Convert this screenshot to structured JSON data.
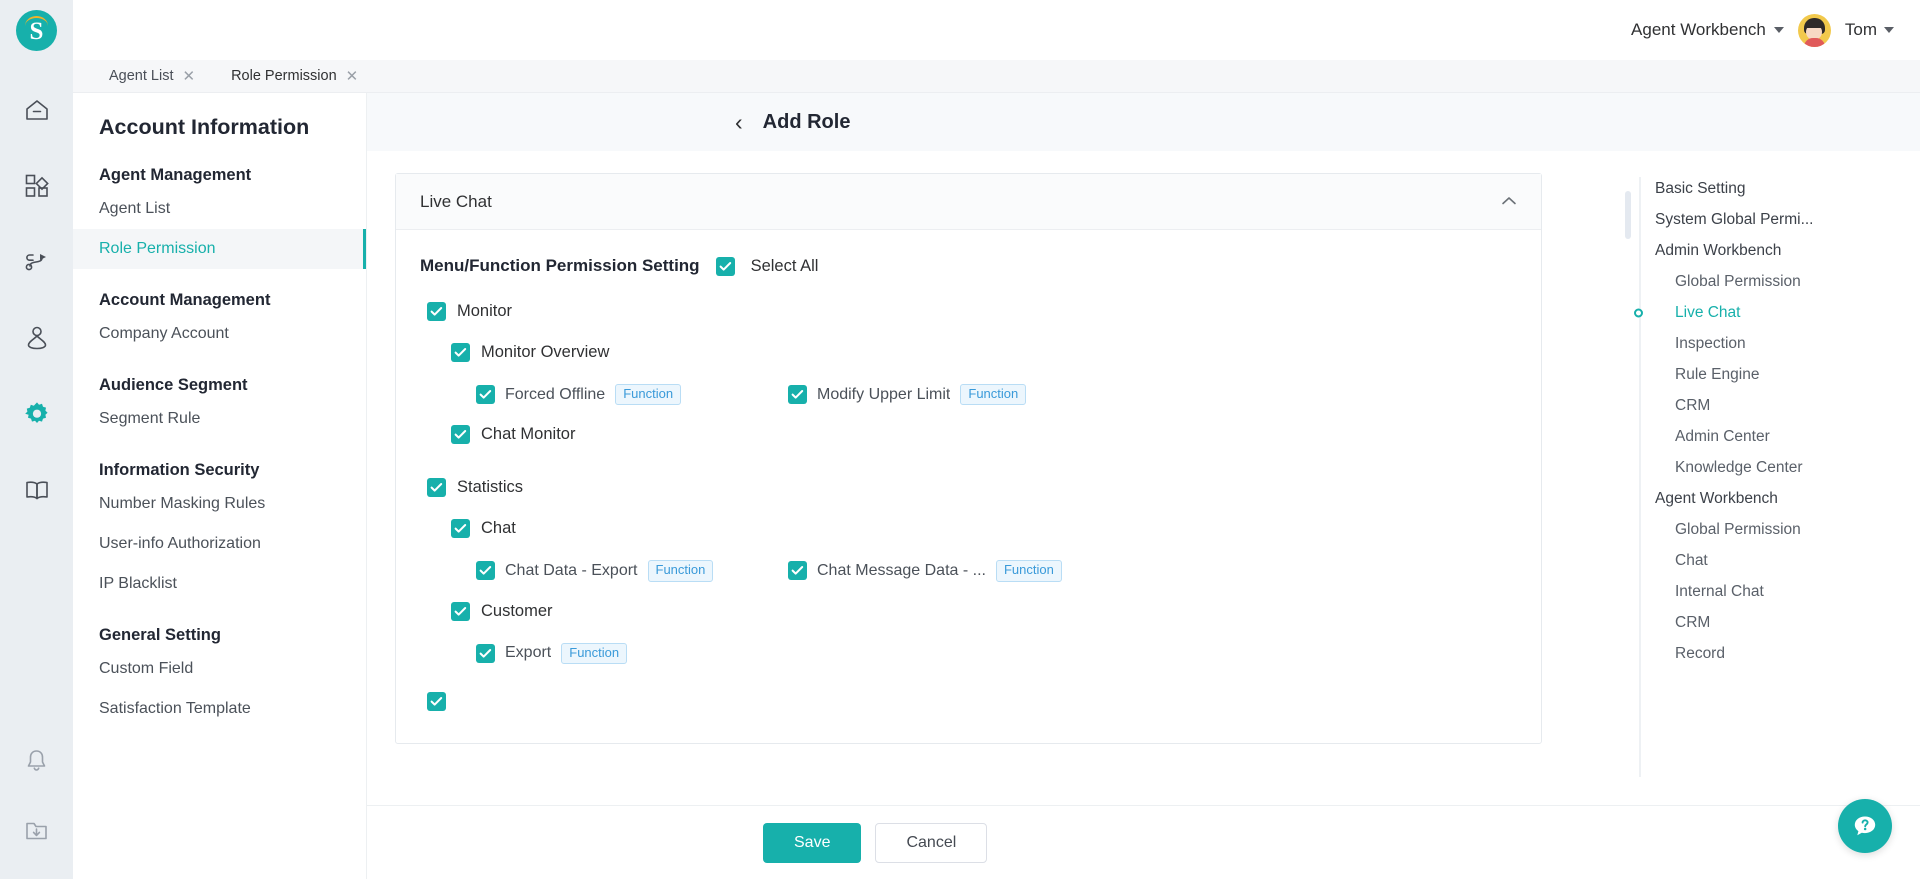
{
  "header": {
    "logo_letter": "S",
    "workbench_label": "Agent Workbench",
    "user_name": "Tom"
  },
  "rail": {
    "icons": [
      {
        "name": "home-icon"
      },
      {
        "name": "apps-grid-icon"
      },
      {
        "name": "routing-flow-icon"
      },
      {
        "name": "audience-person-icon"
      },
      {
        "name": "settings-gear-icon"
      },
      {
        "name": "knowledge-book-icon"
      }
    ],
    "bottom_icons": [
      {
        "name": "notification-bell-icon"
      },
      {
        "name": "download-folder-icon"
      }
    ]
  },
  "tabs": [
    {
      "label": "Agent List",
      "close": "✕"
    },
    {
      "label": "Role Permission",
      "close": "✕"
    }
  ],
  "sidebar": {
    "title": "Account Information",
    "groups": [
      {
        "title": "Agent Management",
        "items": [
          {
            "label": "Agent List",
            "active": false
          },
          {
            "label": "Role Permission",
            "active": true
          }
        ]
      },
      {
        "title": "Account Management",
        "items": [
          {
            "label": "Company Account",
            "active": false
          }
        ]
      },
      {
        "title": "Audience Segment",
        "items": [
          {
            "label": "Segment Rule",
            "active": false
          }
        ]
      },
      {
        "title": "Information Security",
        "items": [
          {
            "label": "Number Masking Rules",
            "active": false
          },
          {
            "label": "User-info Authorization",
            "active": false
          },
          {
            "label": "IP Blacklist",
            "active": false
          }
        ]
      },
      {
        "title": "General Setting",
        "items": [
          {
            "label": "Custom Field",
            "active": false
          },
          {
            "label": "Satisfaction Template",
            "active": false
          }
        ]
      }
    ]
  },
  "page": {
    "back_icon": "‹",
    "title": "Add Role"
  },
  "card": {
    "title": "Live Chat",
    "collapse_icon": "⌃",
    "permission_label": "Menu/Function Permission Setting",
    "select_all_label": "Select All",
    "select_all_checked": true,
    "tree": [
      {
        "label": "Monitor",
        "checked": true,
        "children": [
          {
            "label": "Monitor Overview",
            "checked": true,
            "functions": [
              {
                "label": "Forced Offline",
                "badge": "Function",
                "checked": true
              },
              {
                "label": "Modify Upper Limit",
                "badge": "Function",
                "checked": true
              }
            ]
          },
          {
            "label": "Chat Monitor",
            "checked": true,
            "functions": []
          }
        ]
      },
      {
        "label": "Statistics",
        "checked": true,
        "children": [
          {
            "label": "Chat",
            "checked": true,
            "functions": [
              {
                "label": "Chat Data - Export",
                "badge": "Function",
                "checked": true
              },
              {
                "label": "Chat Message Data - ...",
                "badge": "Function",
                "checked": true
              }
            ]
          },
          {
            "label": "Customer",
            "checked": true,
            "functions": [
              {
                "label": "Export",
                "badge": "Function",
                "checked": true
              }
            ]
          }
        ]
      }
    ]
  },
  "footer": {
    "save_label": "Save",
    "cancel_label": "Cancel"
  },
  "anchor_nav": {
    "items": [
      {
        "label": "Basic Setting",
        "sub": false,
        "active": false
      },
      {
        "label": "System Global Permi...",
        "sub": false,
        "active": false
      },
      {
        "label": "Admin Workbench",
        "sub": false,
        "active": false
      },
      {
        "label": "Global Permission",
        "sub": true,
        "active": false
      },
      {
        "label": "Live Chat",
        "sub": true,
        "active": true
      },
      {
        "label": "Inspection",
        "sub": true,
        "active": false
      },
      {
        "label": "Rule Engine",
        "sub": true,
        "active": false
      },
      {
        "label": "CRM",
        "sub": true,
        "active": false
      },
      {
        "label": "Admin Center",
        "sub": true,
        "active": false
      },
      {
        "label": "Knowledge Center",
        "sub": true,
        "active": false
      },
      {
        "label": "Agent Workbench",
        "sub": false,
        "active": false
      },
      {
        "label": "Global Permission",
        "sub": true,
        "active": false
      },
      {
        "label": "Chat",
        "sub": true,
        "active": false
      },
      {
        "label": "Internal Chat",
        "sub": true,
        "active": false
      },
      {
        "label": "CRM",
        "sub": true,
        "active": false
      },
      {
        "label": "Record",
        "sub": true,
        "active": false
      }
    ]
  },
  "help": {
    "icon": "help-chat-icon"
  },
  "colors": {
    "accent": "#17b0ab",
    "badge_border": "#b9ddf5",
    "badge_bg": "#ecf6fd",
    "badge_text": "#3a9ad9",
    "rail_bg": "#eaeef2"
  }
}
